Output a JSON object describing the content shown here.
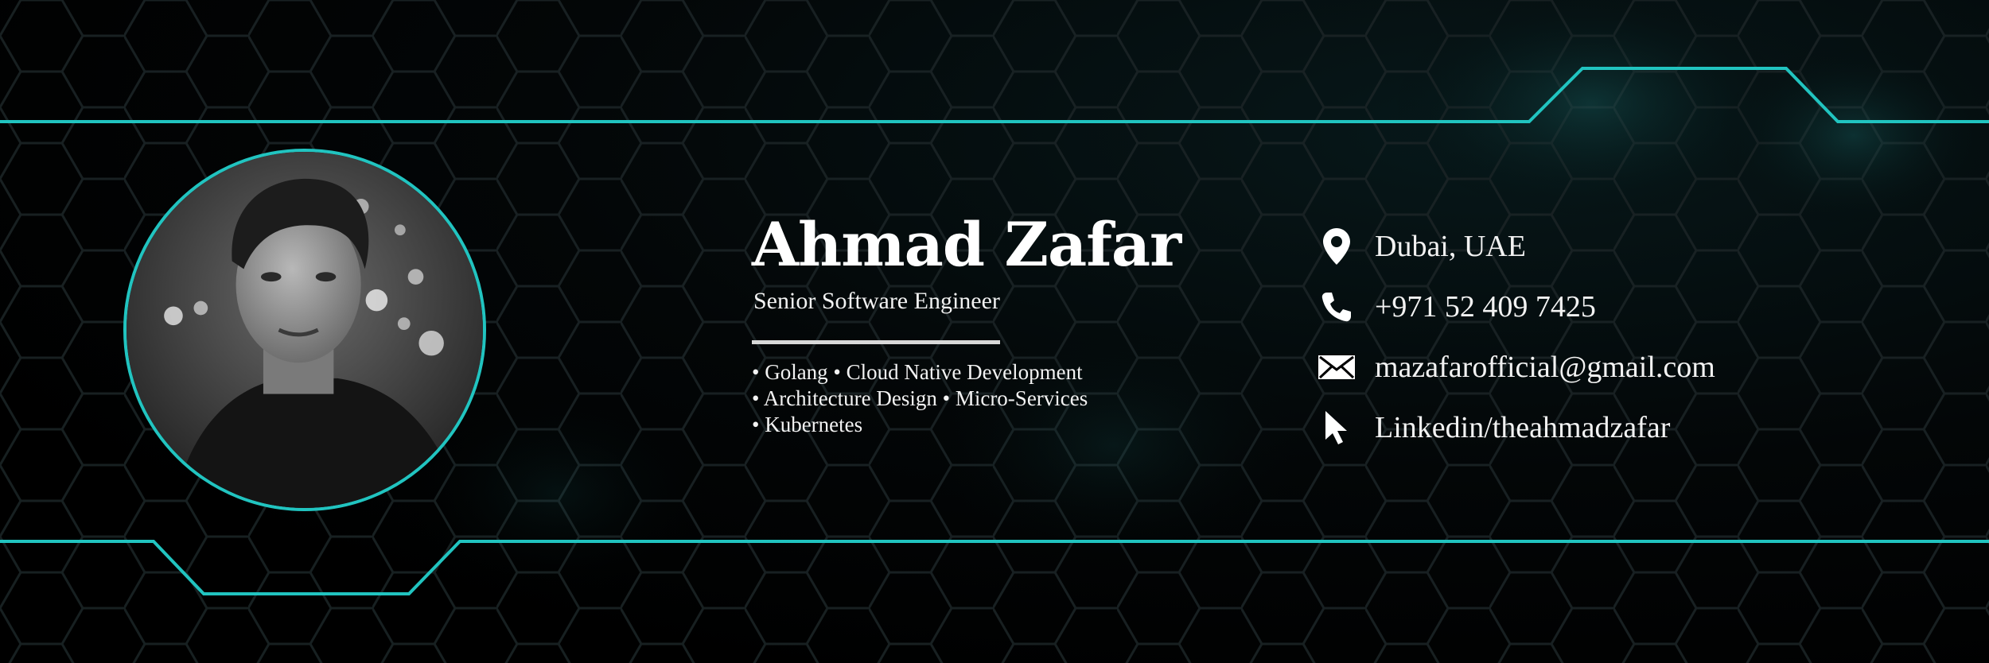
{
  "profile": {
    "name": "Ahmad Zafar",
    "title": "Senior Software Engineer",
    "photo_alt": "Portrait photo"
  },
  "skills": [
    "• Golang • Cloud Native Development",
    "• Architecture Design • Micro-Services",
    "• Kubernetes"
  ],
  "contacts": {
    "location": {
      "icon": "location-pin-icon",
      "text": "Dubai, UAE"
    },
    "phone": {
      "icon": "phone-icon",
      "text": "+971 52 409 7425"
    },
    "email": {
      "icon": "envelope-icon",
      "text": "mazafarofficial@gmail.com"
    },
    "linkedin": {
      "icon": "cursor-icon",
      "text": "Linkedin/theahmadzafar"
    }
  },
  "colors": {
    "accent": "#21c4c0",
    "background": "#000000",
    "text": "#f2f2f2"
  }
}
